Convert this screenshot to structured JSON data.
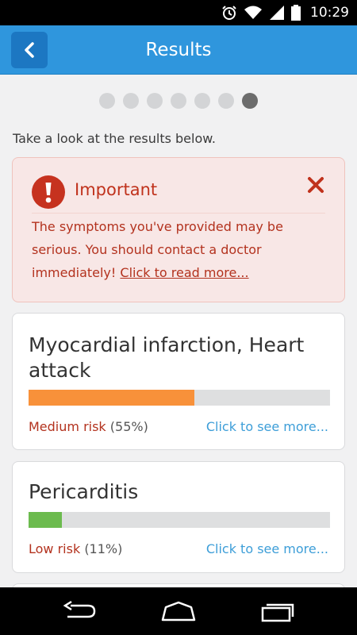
{
  "status_bar": {
    "time": "10:29"
  },
  "header": {
    "title": "Results"
  },
  "pager": {
    "count": 7,
    "active_index": 6
  },
  "intro": "Take a look at the results below.",
  "alert": {
    "title": "Important",
    "message": "The symptoms you've provided may be serious. You should contact a doctor immediately! ",
    "link": "Click to read more..."
  },
  "results": [
    {
      "name": "Myocardial infarction, Heart attack",
      "risk_label": "Medium risk",
      "percent_text": "(55%)",
      "percent": 55,
      "color": "#f8913a",
      "link": "Click to see more..."
    },
    {
      "name": "Pericarditis",
      "risk_label": "Low risk",
      "percent_text": "(11%)",
      "percent": 11,
      "color": "#6cbb4e",
      "link": "Click to see more..."
    }
  ],
  "colors": {
    "header": "#2f96dd",
    "alert_text": "#b3321e",
    "link": "#3d9ed8"
  }
}
